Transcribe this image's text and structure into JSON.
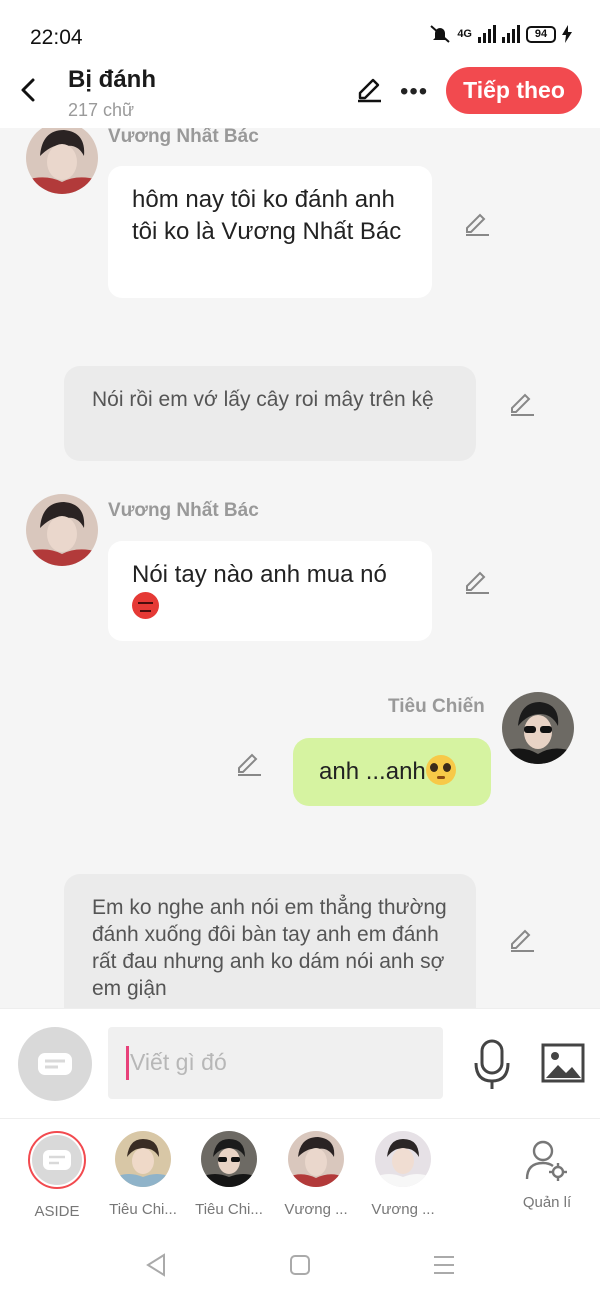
{
  "status_bar": {
    "time": "22:04",
    "network": "4G",
    "battery": "94"
  },
  "header": {
    "title": "Bị đánh",
    "subtitle": "217 chữ",
    "next_label": "Tiếp theo"
  },
  "messages": [
    {
      "kind": "character",
      "sender": "Vương Nhất Bác",
      "text": "hôm nay tôi ko đánh anh tôi ko là Vương Nhất Bác"
    },
    {
      "kind": "narration",
      "text": "Nói rồi em vớ lấy cây roi mây trên kệ"
    },
    {
      "kind": "character",
      "sender": "Vương Nhất Bác",
      "text": "Nói tay nào anh mua nó"
    },
    {
      "kind": "self",
      "sender": "Tiêu Chiến",
      "text": "anh ...anh"
    },
    {
      "kind": "narration",
      "text": "Em ko nghe anh nói em thẳng thường đánh xuống đôi bàn tay anh em đánh rất đau nhưng anh ko dám nói anh sợ em giận"
    }
  ],
  "input": {
    "placeholder": "Viết gì đó"
  },
  "characters": [
    {
      "label": "ASIDE"
    },
    {
      "label": "Tiêu Chi..."
    },
    {
      "label": "Tiêu Chi..."
    },
    {
      "label": "Vương ..."
    },
    {
      "label": "Vương ..."
    }
  ],
  "manage": {
    "label": "Quản lí"
  },
  "colors": {
    "accent": "#f24a4f",
    "self_bubble": "#d6f3a1",
    "narration_bubble": "#ebebeb"
  },
  "icons": [
    "back-icon",
    "pencil-icon",
    "more-icon",
    "aside-icon",
    "mic-icon",
    "image-icon",
    "manage-user-icon",
    "nav-back-icon",
    "nav-home-icon",
    "nav-menu-icon"
  ]
}
